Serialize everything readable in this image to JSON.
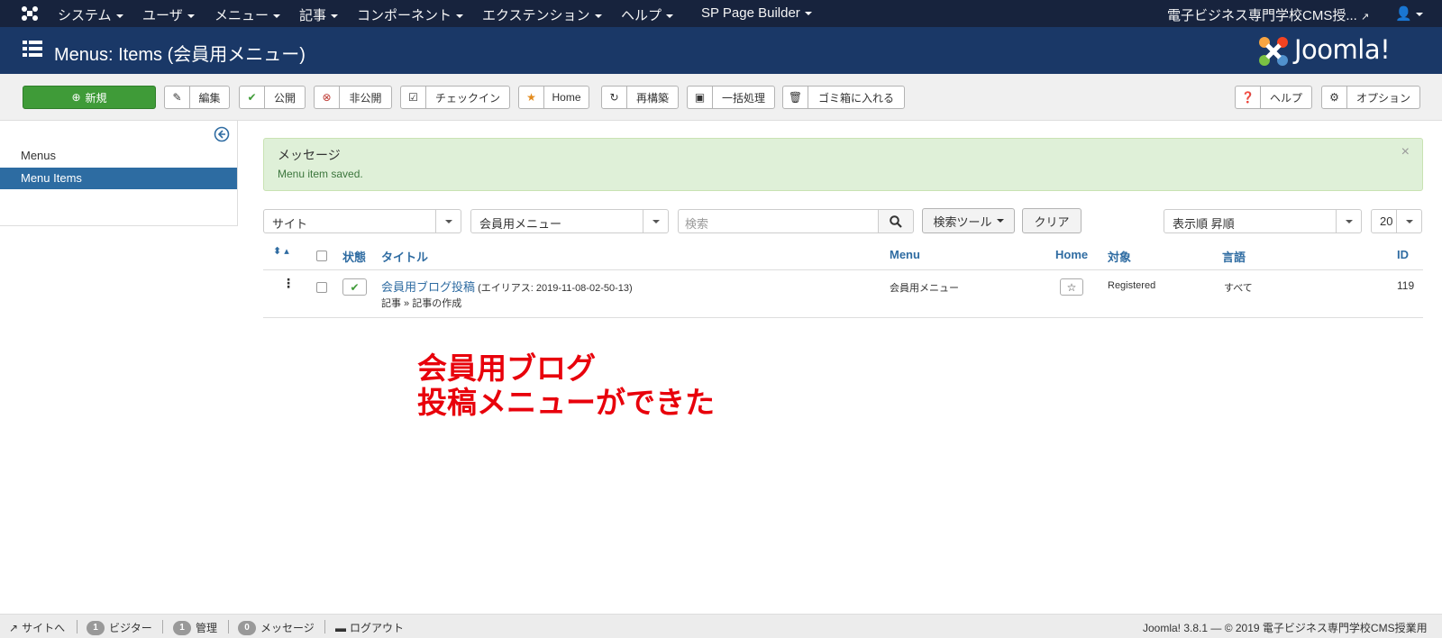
{
  "navbar": {
    "items": [
      "システム",
      "ユーザ",
      "メニュー",
      "記事",
      "コンポーネント",
      "エクステンション",
      "ヘルプ",
      "SP Page Builder"
    ],
    "site_name": "電子ビジネス専門学校CMS授..."
  },
  "header": {
    "title": "Menus: Items (会員用メニュー)",
    "brand": "Joomla!"
  },
  "toolbar": {
    "new": "新規",
    "edit": "編集",
    "publish": "公開",
    "unpublish": "非公開",
    "checkin": "チェックイン",
    "home": "Home",
    "rebuild": "再構築",
    "batch": "一括処理",
    "trash": "ゴミ箱に入れる",
    "help": "ヘルプ",
    "options": "オプション"
  },
  "sidebar": {
    "items": [
      "Menus",
      "Menu Items"
    ],
    "active": "Menu Items"
  },
  "message": {
    "heading": "メッセージ",
    "text": "Menu item saved.",
    "close": "×"
  },
  "filters": {
    "client": "サイト",
    "menu": "会員用メニュー",
    "search_placeholder": "検索",
    "search_tools": "検索ツール",
    "clear": "クリア",
    "ordering": "表示順 昇順",
    "limit": "20"
  },
  "table": {
    "headers": {
      "status": "状態",
      "title": "タイトル",
      "menu": "Menu",
      "home": "Home",
      "access": "対象",
      "language": "言語",
      "id": "ID"
    },
    "rows": [
      {
        "title": "会員用ブログ投稿",
        "alias": "(エイリアス: 2019-11-08-02-50-13)",
        "type": "記事 » 記事の作成",
        "menu": "会員用メニュー",
        "access": "Registered",
        "language": "すべて",
        "id": "119"
      }
    ]
  },
  "annotation": {
    "line1": "会員用ブログ",
    "line2": "投稿メニューができた"
  },
  "statusbar": {
    "view_site": "サイトへ",
    "visitors_count": "1",
    "visitors": "ビジター",
    "admins_count": "1",
    "admins": "管理",
    "messages_count": "0",
    "messages": "メッセージ",
    "logout": "ログアウト",
    "footer": "Joomla! 3.8.1 — © 2019 電子ビジネス専門学校CMS授業用"
  },
  "colors": {
    "navbar": "#17233d",
    "header": "#1a3867",
    "new_button": "#3f9b38",
    "link": "#2f6ca2",
    "annotation": "#e8000b"
  }
}
